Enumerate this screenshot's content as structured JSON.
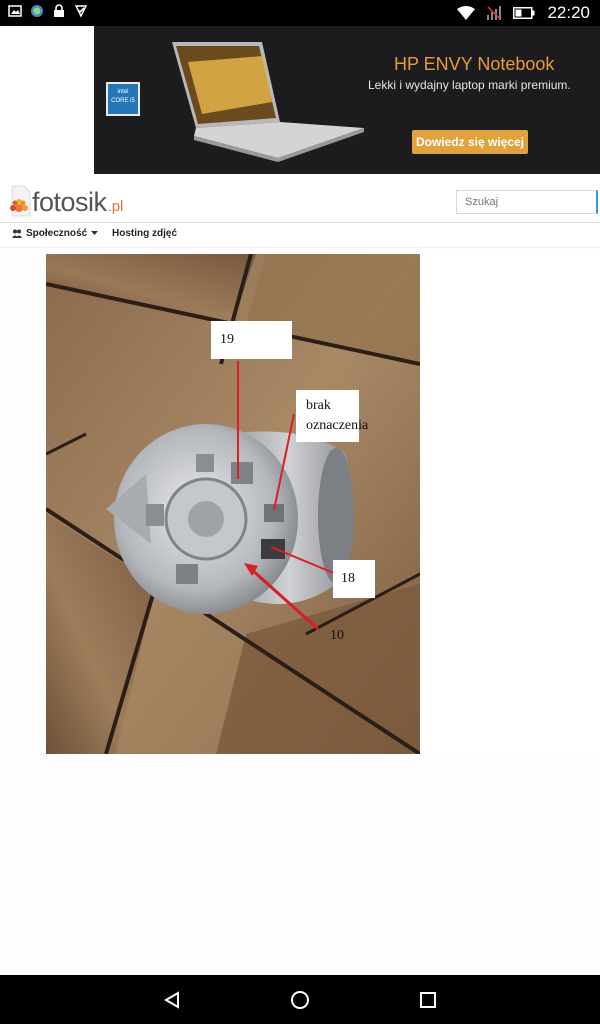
{
  "status_bar": {
    "time": "22:20",
    "left_icons": [
      "image-icon",
      "globe-icon",
      "lock-icon",
      "checkmark-icon"
    ],
    "right_icons": [
      "wifi-icon",
      "signal-icon",
      "battery-icon"
    ]
  },
  "ad": {
    "title": "HP ENVY Notebook",
    "subtitle": "Lekki i wydajny laptop marki premium.",
    "cta": "Dowiedz się więcej",
    "badge": "CORE i5"
  },
  "site": {
    "logo_text": "fotosik",
    "logo_ext": ".pl",
    "search_placeholder": "Szukaj"
  },
  "nav": {
    "community": "Społeczność",
    "hosting": "Hosting zdjęć"
  },
  "photo_labels": {
    "label_19": "19",
    "label_brak_line1": "brak",
    "label_brak_line2": "oznaczenia",
    "label_18": "18",
    "label_10": "10"
  },
  "colors": {
    "accent_orange": "#e8743b",
    "ad_title": "#e89a3c",
    "cta_bg": "#e0a23c",
    "search_border": "#2d9bd9"
  }
}
